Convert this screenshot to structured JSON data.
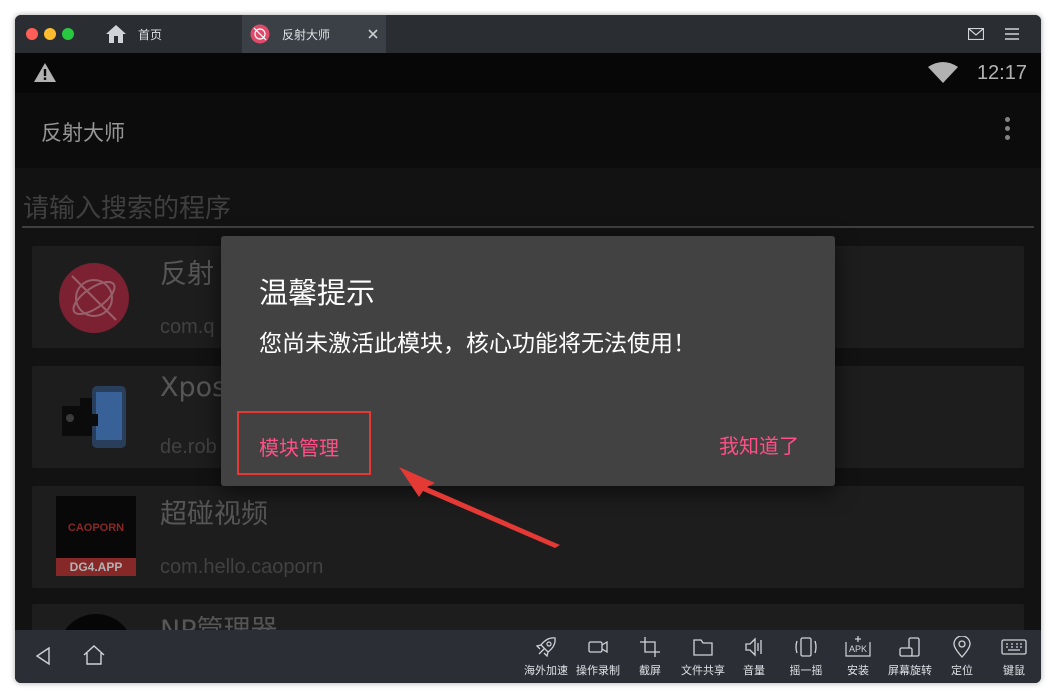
{
  "tabs": [
    {
      "label": "首页"
    },
    {
      "label": "反射大师"
    }
  ],
  "status": {
    "time": "12:17"
  },
  "appbar": {
    "title": "反射大师"
  },
  "search": {
    "placeholder": "请输入搜索的程序"
  },
  "apps": [
    {
      "title": "反射",
      "package": "com.q"
    },
    {
      "title": "Xpos",
      "package": "de.rob"
    },
    {
      "title": "超碰视频",
      "package": "com.hello.caoporn",
      "icon_text_top": "CAOPORN",
      "icon_text_bottom": "DG4.APP"
    },
    {
      "title": "NP管理器"
    }
  ],
  "dialog": {
    "title": "温馨提示",
    "message": "您尚未激活此模块，核心功能将无法使用！",
    "left_button": "模块管理",
    "right_button": "我知道了"
  },
  "toolbar": [
    {
      "label": "海外加速",
      "icon": "rocket-icon"
    },
    {
      "label": "操作录制",
      "icon": "video-icon"
    },
    {
      "label": "截屏",
      "icon": "crop-icon"
    },
    {
      "label": "文件共享",
      "icon": "folder-icon"
    },
    {
      "label": "音量",
      "icon": "volume-icon"
    },
    {
      "label": "摇一摇",
      "icon": "shake-icon"
    },
    {
      "label": "安装",
      "icon": "apk-icon",
      "icon_text": "APK"
    },
    {
      "label": "屏幕旋转",
      "icon": "rotate-icon"
    },
    {
      "label": "定位",
      "icon": "location-icon"
    },
    {
      "label": "键鼠",
      "icon": "keyboard-icon"
    }
  ],
  "colors": {
    "accent": "#ff4f86",
    "highlight": "#e53935",
    "arrow": "#e53935",
    "dialog_bg": "#424242"
  }
}
